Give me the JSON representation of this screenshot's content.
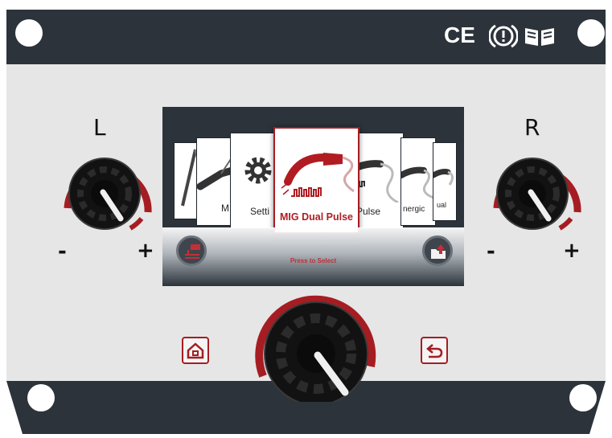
{
  "panel": {
    "left_label": "L",
    "right_label": "R",
    "left_minus": "-",
    "left_plus": "+",
    "right_minus": "-",
    "right_plus": "+",
    "cert_ce": "CE",
    "icons": [
      "ce-mark",
      "warning-icon",
      "manual-book-icon",
      "home-icon",
      "back-icon"
    ]
  },
  "screen": {
    "menu_items": [
      {
        "label": "",
        "icon": "torch-icon"
      },
      {
        "label": "MM",
        "icon": "electrode-holder-icon"
      },
      {
        "label": "Setti",
        "icon": "gear-icon"
      },
      {
        "label": "MIG Dual Pulse",
        "icon": "mig-torch-icon",
        "selected": true
      },
      {
        "label": "Pulse",
        "icon": "mig-torch-icon"
      },
      {
        "label": "nergic",
        "icon": "mig-torch-icon"
      },
      {
        "label": "ual",
        "icon": "mig-torch-icon"
      }
    ],
    "selected_label": "MIG Dual Pulse",
    "hint": "Press to Select"
  },
  "colors": {
    "frame": "#2c333b",
    "panel": "#e6e6e6",
    "accent": "#a51d22",
    "knob": "#111111"
  }
}
